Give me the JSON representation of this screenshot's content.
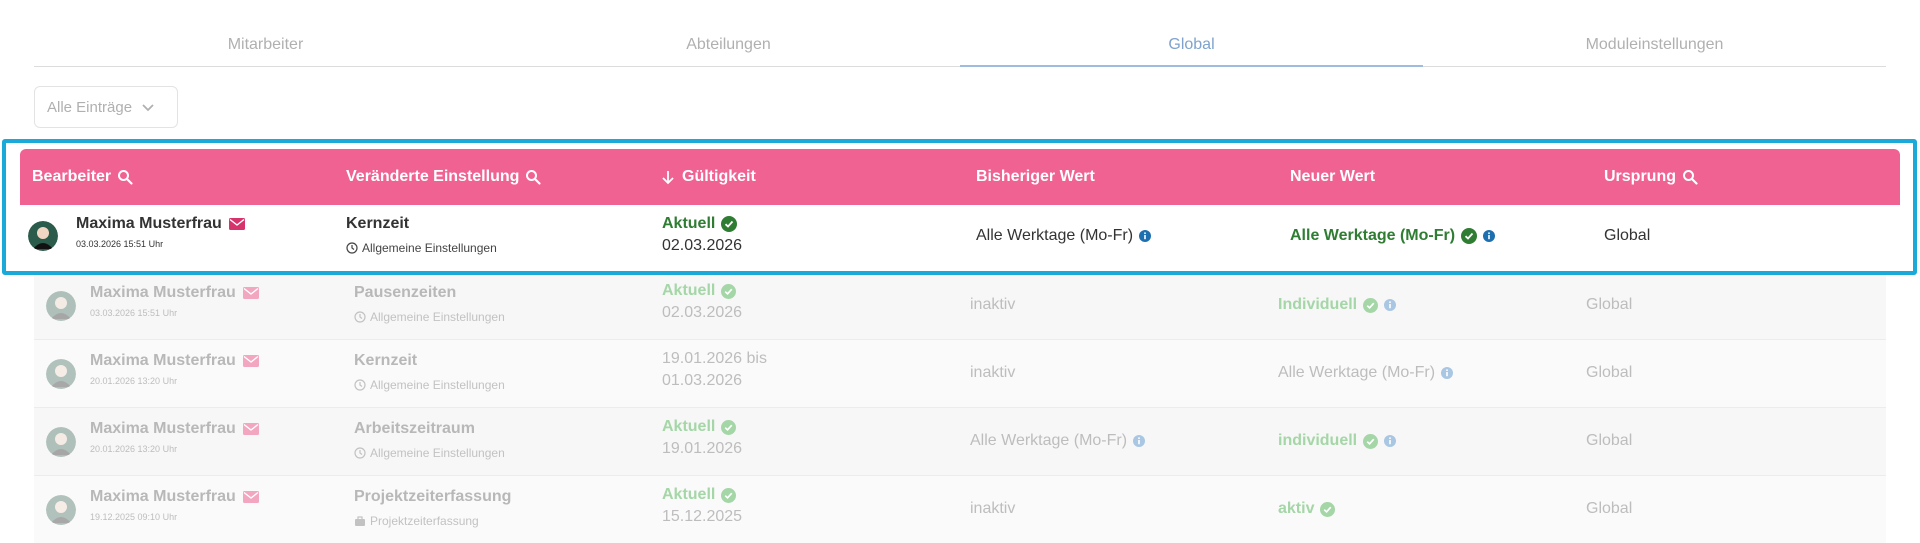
{
  "tabs": [
    {
      "label": "Mitarbeiter"
    },
    {
      "label": "Abteilungen"
    },
    {
      "label": "Global"
    },
    {
      "label": "Moduleinstellungen"
    }
  ],
  "active_tab": "Global",
  "filter": {
    "label": "Alle Einträge"
  },
  "table": {
    "headers": {
      "editor": "Bearbeiter",
      "setting": "Veränderte Einstellung",
      "validity": "Gültigkeit",
      "old_value": "Bisheriger Wert",
      "new_value": "Neuer Wert",
      "origin": "Ursprung"
    },
    "highlighted_row": {
      "editor": "Maxima Musterfrau",
      "timestamp": "03.03.2026 15:51 Uhr",
      "setting": "Kernzeit",
      "category": "Allgemeine Einstellungen",
      "validity_status": "Aktuell",
      "validity_date": "02.03.2026",
      "old_value": "Alle Werktage (Mo-Fr)",
      "new_value": "Alle Werktage (Mo-Fr)",
      "origin": "Global"
    },
    "rows": [
      {
        "editor": "Maxima Musterfrau",
        "timestamp": "03.03.2026 15:51 Uhr",
        "setting": "Pausenzeiten",
        "category": "Allgemeine Einstellungen",
        "validity_status": "Aktuell",
        "validity_line1": "",
        "validity_date": "02.03.2026",
        "old_value": "inaktiv",
        "new_value": "Individuell",
        "origin": "Global"
      },
      {
        "editor": "Maxima Musterfrau",
        "timestamp": "20.01.2026 13:20 Uhr",
        "setting": "Kernzeit",
        "category": "Allgemeine Einstellungen",
        "validity_status": "",
        "validity_line1": "19.01.2026 bis",
        "validity_date": "01.03.2026",
        "old_value": "inaktiv",
        "new_value": "Alle Werktage (Mo-Fr)",
        "origin": "Global"
      },
      {
        "editor": "Maxima Musterfrau",
        "timestamp": "20.01.2026 13:20 Uhr",
        "setting": "Arbeitszeitraum",
        "category": "Allgemeine Einstellungen",
        "validity_status": "Aktuell",
        "validity_line1": "",
        "validity_date": "19.01.2026",
        "old_value": "Alle Werktage (Mo-Fr)",
        "new_value": "individuell",
        "origin": "Global"
      },
      {
        "editor": "Maxima Musterfrau",
        "timestamp": "19.12.2025 09:10 Uhr",
        "setting": "Projektzeiterfassung",
        "category": "Projektzeiterfassung",
        "validity_status": "Aktuell",
        "validity_line1": "",
        "validity_date": "15.12.2025",
        "old_value": "inaktiv",
        "new_value": "aktiv",
        "origin": "Global"
      }
    ]
  },
  "colors": {
    "header_bg": "#f06292",
    "highlight_border": "#1aa9d9",
    "active_tab": "#7fa3cc",
    "status_green": "#2e7d32",
    "info_blue": "#1e6fb0",
    "mail_pink": "#d6336c"
  }
}
